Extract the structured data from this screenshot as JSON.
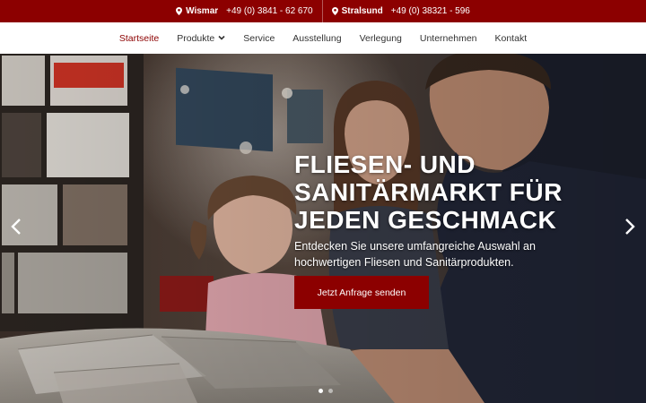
{
  "topbar": {
    "locations": [
      {
        "city": "Wismar",
        "phone": "+49 (0) 3841 - 62 670",
        "icon": "map-pin-icon"
      },
      {
        "city": "Stralsund",
        "phone": "+49 (0) 38321 - 596",
        "icon": "map-pin-icon"
      }
    ],
    "color": "#8c0000"
  },
  "nav": {
    "items": [
      {
        "label": "Startseite",
        "active": true
      },
      {
        "label": "Produkte",
        "dropdown": true
      },
      {
        "label": "Service"
      },
      {
        "label": "Ausstellung"
      },
      {
        "label": "Verlegung"
      },
      {
        "label": "Unternehmen"
      },
      {
        "label": "Kontakt"
      }
    ],
    "active_color": "#8c0000"
  },
  "hero": {
    "headline": "Fliesen- und Sanitärmarkt für jeden Geschmack",
    "subline": "Entdecken Sie unsere umfangreiche Auswahl an hochwertigen Fliesen und Sanitärprodukten.",
    "cta_label": "Jetzt Anfrage senden",
    "slides_count": 2,
    "active_slide": 1,
    "prev_icon": "chevron-left-icon",
    "next_icon": "chevron-right-icon"
  }
}
